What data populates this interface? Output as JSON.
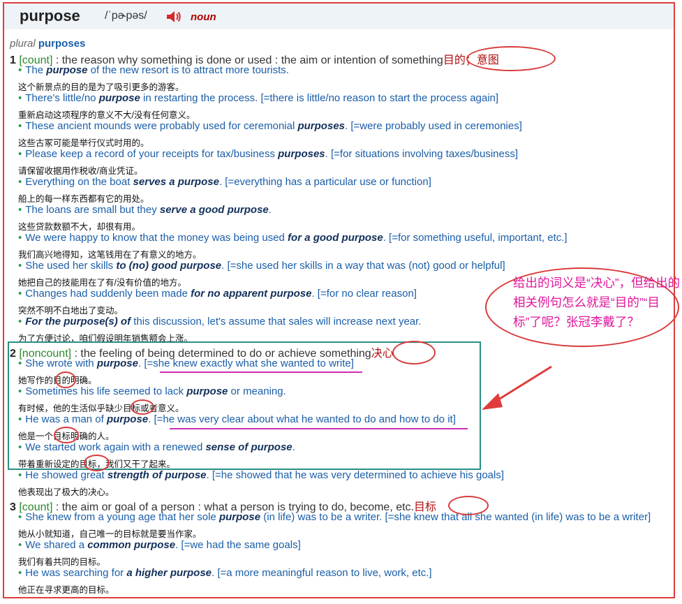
{
  "header": {
    "word": "purpose",
    "pronunciation": "/ˈpɚpəs/",
    "speaker_icon": "speaker-icon",
    "pos": "noun"
  },
  "plural": {
    "label": "plural",
    "word": "purposes"
  },
  "senses": [
    {
      "num": "1",
      "gram": "[count]",
      "def": " : the reason why something is done or used : the aim or intention of something",
      "cn_note": "目的；意图",
      "examples": [
        {
          "pre": "The ",
          "b": "purpose",
          "post": " of the new resort is to attract more tourists.",
          "tr": "这个新景点的目的是为了吸引更多的游客。"
        },
        {
          "pre": "There's little/no ",
          "b": "purpose",
          "post": " in restarting the process. [=there is little/no reason to start the process again]",
          "tr": "重新启动这项程序的意义不大/没有任何意义。"
        },
        {
          "pre": "These ancient mounds were probably used for ceremonial ",
          "b": "purposes",
          "post": ". [=were probably used in ceremonies]",
          "tr": "这些古冢可能是举行仪式时用的。"
        },
        {
          "pre": "Please keep a record of your receipts for tax/business ",
          "b": "purposes",
          "post": ". [=for situations involving taxes/business]",
          "tr": "请保留收据用作税收/商业凭证。"
        },
        {
          "pre": "Everything on the boat ",
          "b": "serves a purpose",
          "post": ". [=everything has a particular use or function]",
          "tr": "船上的每一样东西都有它的用处。"
        },
        {
          "pre": "The loans are small but they ",
          "b": "serve a good purpose",
          "post": ".",
          "tr": "这些贷款数额不大，却很有用。"
        },
        {
          "pre": "We were happy to know that the money was being used ",
          "b": "for a good purpose",
          "post": ". [=for something useful, important, etc.]",
          "tr": "我们高兴地得知，这笔钱用在了有意义的地方。"
        },
        {
          "pre": "She used her skills ",
          "b": "to (no) good purpose",
          "post": ". [=she used her skills in a way that was (not) good or helpful]",
          "tr": "她把自己的技能用在了有/没有价值的地方。"
        },
        {
          "pre": "Changes had suddenly been made ",
          "b": "for no apparent purpose",
          "post": ". [=for no clear reason]",
          "tr": "突然不明不白地出了变动。"
        },
        {
          "pre": "",
          "b": "For the purpose(s) of",
          "post": " this discussion, let's assume that sales will increase next year.",
          "tr": "为了方便讨论，咱们假设明年销售额会上涨。"
        }
      ]
    },
    {
      "num": "2",
      "gram": "[noncount]",
      "def": " : the feeling of being determined to do or achieve something",
      "cn_note": "决心",
      "examples": [
        {
          "pre": "She wrote with ",
          "b": "purpose",
          "post": ". [=she knew exactly what she wanted to write]",
          "tr": "她写作的目的明确。"
        },
        {
          "pre": "Sometimes his life seemed to lack ",
          "b": "purpose",
          "post": " or meaning.",
          "tr": "有时候，他的生活似乎缺少目标或者意义。"
        },
        {
          "pre": "He was a man of ",
          "b": "purpose",
          "post": ". [=he was very clear about what he wanted to do and how to do it]",
          "tr": "他是一个目标明确的人。"
        },
        {
          "pre": "We started work again with a renewed ",
          "b": "sense of purpose",
          "post": ".",
          "tr": "带着重新设定的目标，我们又干了起来。"
        },
        {
          "pre": "He showed great ",
          "b": "strength of purpose",
          "post": ". [=he showed that he was very determined to achieve his goals]",
          "tr": "他表现出了极大的决心。"
        }
      ]
    },
    {
      "num": "3",
      "gram": "[count]",
      "def": " : the aim or goal of a person : what a person is trying to do, become, etc.",
      "cn_note": "目标",
      "examples": [
        {
          "pre": "She knew from a young age that her sole ",
          "b": "purpose",
          "post": " (in life) was to be a writer. [=she knew that all she wanted (in life) was to be a writer]",
          "tr": "她从小就知道，自己唯一的目标就是要当作家。"
        },
        {
          "pre": "We shared a ",
          "b": "common purpose",
          "post": ". [=we had the same goals]",
          "tr": "我们有着共同的目标。"
        },
        {
          "pre": "He was searching for ",
          "b": "a higher purpose",
          "post": ". [=a more meaningful reason to live, work, etc.]",
          "tr": "他正在寻求更高的目标。"
        }
      ]
    }
  ],
  "annotation": "给出的词义是“决心”，但给出的相关例句怎么就是“目的”“目标”了呢？张冠李戴了？",
  "colors": {
    "frame": "#e03c3c",
    "box": "#2a8f86",
    "note": "#e0169c",
    "link_blue": "#1a5ea8"
  }
}
